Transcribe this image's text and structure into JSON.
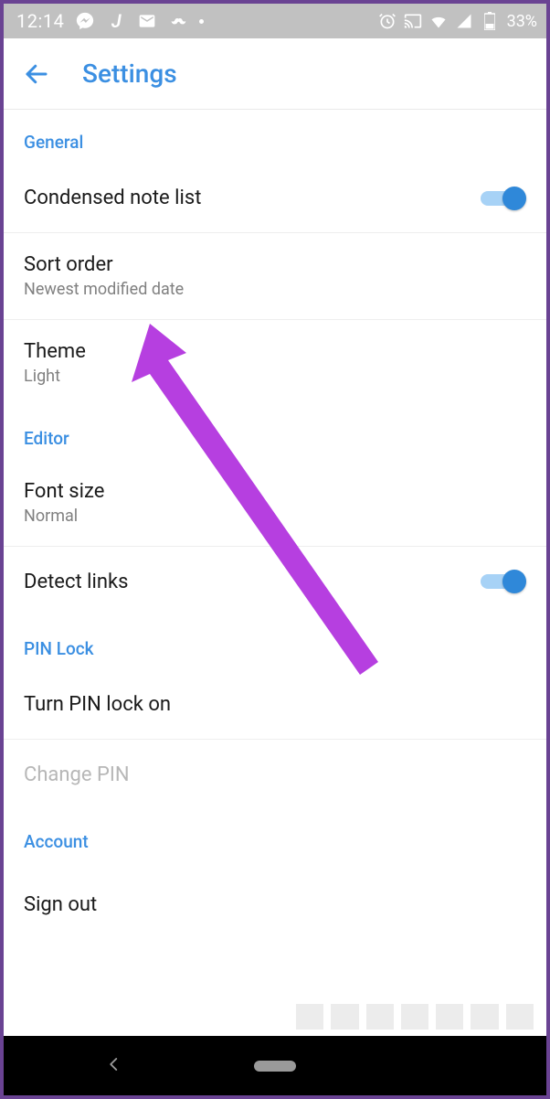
{
  "status": {
    "time": "12:14",
    "battery_text": "33%"
  },
  "header": {
    "title": "Settings"
  },
  "sections": {
    "general": {
      "label": "General",
      "condensed": {
        "title": "Condensed note list"
      },
      "sort": {
        "title": "Sort order",
        "sub": "Newest modified date"
      },
      "theme": {
        "title": "Theme",
        "sub": "Light"
      }
    },
    "editor": {
      "label": "Editor",
      "font": {
        "title": "Font size",
        "sub": "Normal"
      },
      "detect": {
        "title": "Detect links"
      }
    },
    "pinlock": {
      "label": "PIN Lock",
      "turn_on": {
        "title": "Turn PIN lock on"
      },
      "change": {
        "title": "Change PIN"
      }
    },
    "account": {
      "label": "Account",
      "signout": {
        "title": "Sign out"
      }
    }
  }
}
